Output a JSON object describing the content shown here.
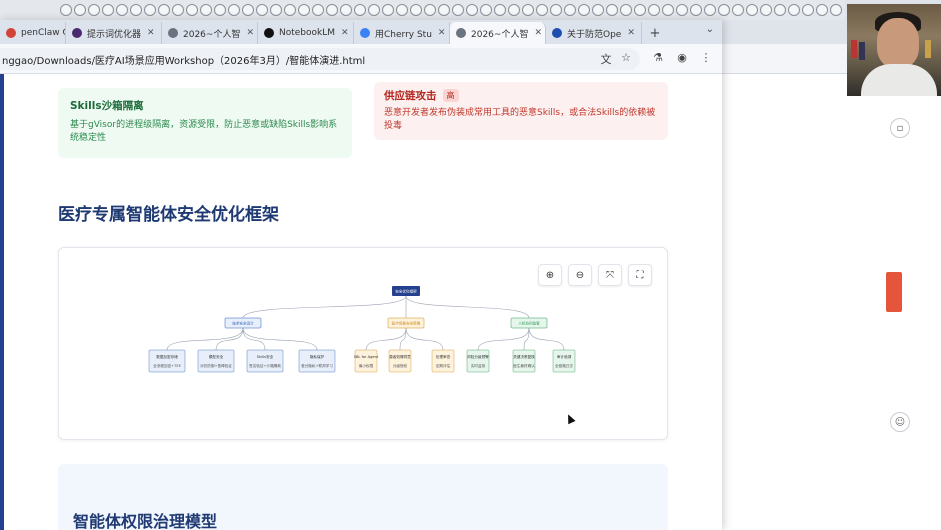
{
  "browser": {
    "tabs": [
      {
        "label": "penClaw Co",
        "icon_color": "#d0453a"
      },
      {
        "label": "提示词优化器",
        "icon_color": "#4a2a6e"
      },
      {
        "label": "2026~个人智",
        "icon_color": "#6b7280"
      },
      {
        "label": "NotebookLM",
        "icon_color": "#111111"
      },
      {
        "label": "用Cherry Stu",
        "icon_color": "#3b82f6"
      },
      {
        "label": "2026~个人智",
        "icon_color": "#6b7280",
        "active": true
      },
      {
        "label": "关于防范Ope",
        "icon_color": "#1e4fb0"
      }
    ],
    "url": "nggao/Downloads/医疗AI场景应用Workshop（2026年3月）/智能体演进.html"
  },
  "page": {
    "green_card": {
      "title": "Skills沙箱隔离",
      "text": "基于gVisor的进程级隔离，资源受限，防止恶意或缺陷Skills影响系统稳定性"
    },
    "red_card": {
      "title": "供应链攻击",
      "badge": "高",
      "text": "恶意开发者发布伪装成常用工具的恶意Skills，或合法Skills的依赖被投毒"
    },
    "section_title": "医疗专属智能体安全优化框架",
    "lower_title": "智能体权限治理模型"
  },
  "diagram": {
    "root": "安全优化框架",
    "groups": [
      {
        "label": "技术安全设计",
        "color": "#2b5fb8",
        "children": [
          {
            "label": "数据加密存储",
            "sub": "全流程加密+TEE"
          },
          {
            "label": "模型安全",
            "sub": "对抗防御+鲁棒验证"
          },
          {
            "label": "Skills安全",
            "sub": "签名验证+沙箱隔离"
          },
          {
            "label": "隐私保护",
            "sub": "差分隐私+联邦学习"
          }
        ]
      },
      {
        "label": "医疗场景安全策略",
        "color": "#d08a1a",
        "children": [
          {
            "label": "SBL for Agent",
            "sub": "最小权限"
          },
          {
            "label": "患者知情同意",
            "sub": "分级授权"
          },
          {
            "label": "伦理审查",
            "sub": "定期评估"
          }
        ]
      },
      {
        "label": "人机协同监管",
        "color": "#2f9a57",
        "children": [
          {
            "label": "风险分级预警",
            "sub": "实时监测"
          },
          {
            "label": "关键决策复核",
            "sub": "医生最终确认"
          },
          {
            "label": "审计追溯",
            "sub": "全链路日志"
          }
        ]
      }
    ]
  }
}
